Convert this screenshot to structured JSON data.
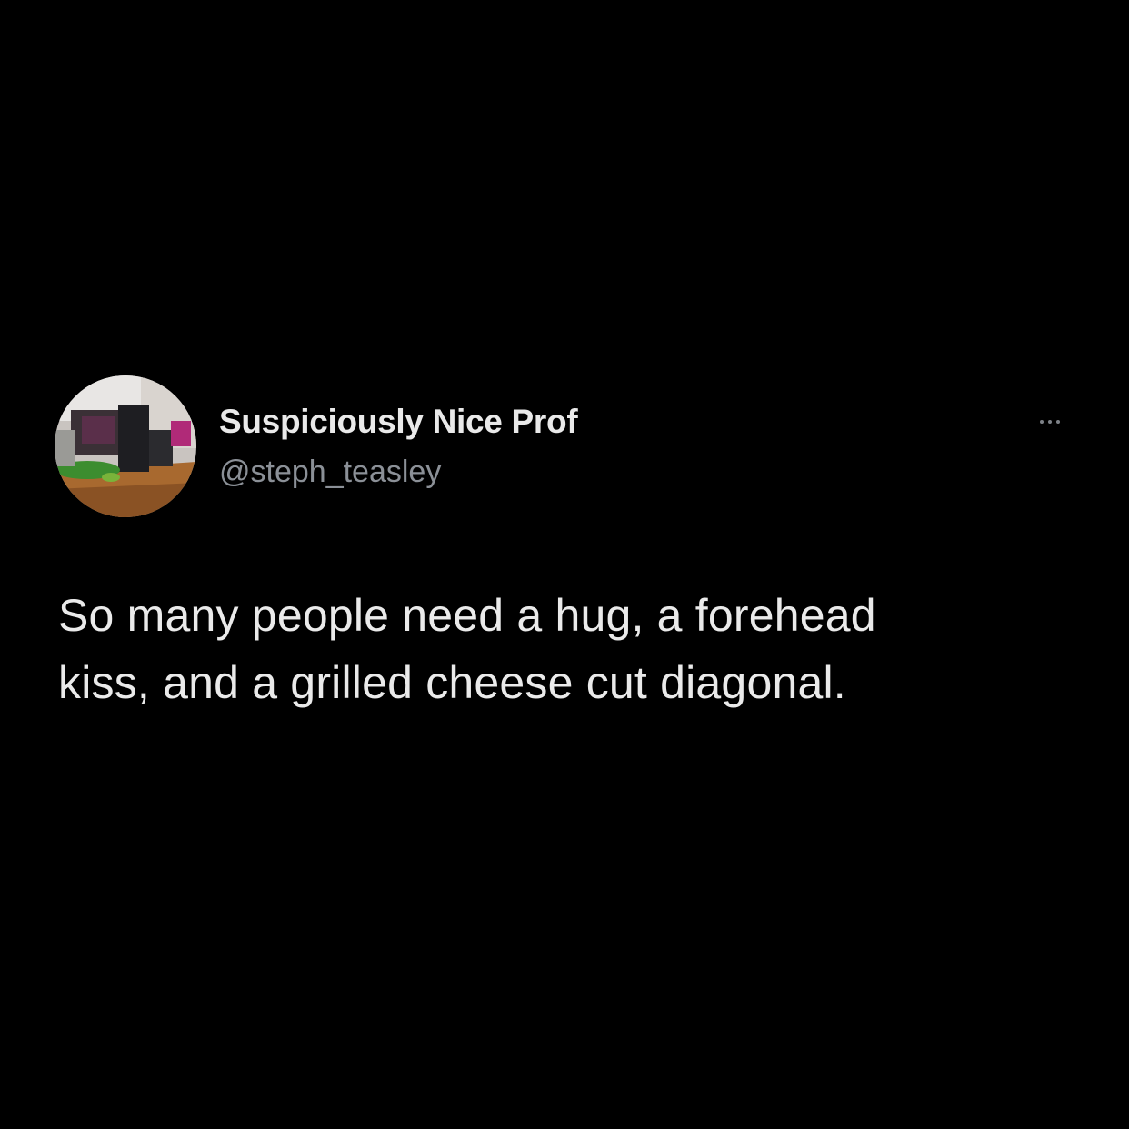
{
  "tweet": {
    "author": {
      "display_name": "Suspiciously Nice Prof",
      "handle": "@steph_teasley",
      "avatar_icon": "profile-photo"
    },
    "more_icon": "ellipsis-icon",
    "text": "So many people need a hug, a forehead\nkiss, and a grilled cheese cut diagonal."
  },
  "colors": {
    "background": "#000000",
    "primary_text": "#e9e9e9",
    "secondary_text": "#8b9097"
  }
}
